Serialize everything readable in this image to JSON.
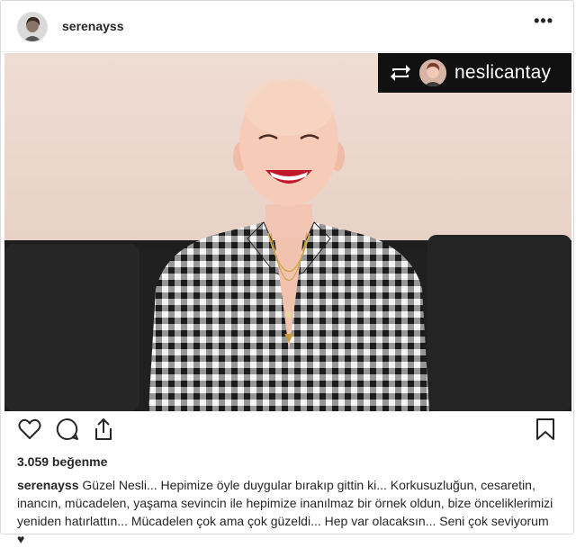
{
  "header": {
    "username": "serenayss",
    "more_label": "•••"
  },
  "repost": {
    "icon": "repost-icon",
    "username": "neslicantay"
  },
  "actions": {
    "like_icon": "heart-icon",
    "comment_icon": "comment-icon",
    "share_icon": "share-icon",
    "save_icon": "bookmark-icon"
  },
  "likes": "3.059 beğenme",
  "caption": {
    "username": "serenayss",
    "text": "Güzel Nesli... Hepimize öyle duygular bırakıp gittin ki... Korkusuzluğun, cesaretin, inancın, mücadelen, yaşama sevincin ile hepimize inanılmaz bir örnek oldun, bize önceliklerimizi yeniden hatırlattın... Mücadelen çok ama çok güzeldi... Hep var olacaksın... Seni çok seviyorum ♥"
  },
  "colors": {
    "photo_bg": "#ead5cc",
    "badge_bg": "#111111",
    "text": "#262626"
  }
}
